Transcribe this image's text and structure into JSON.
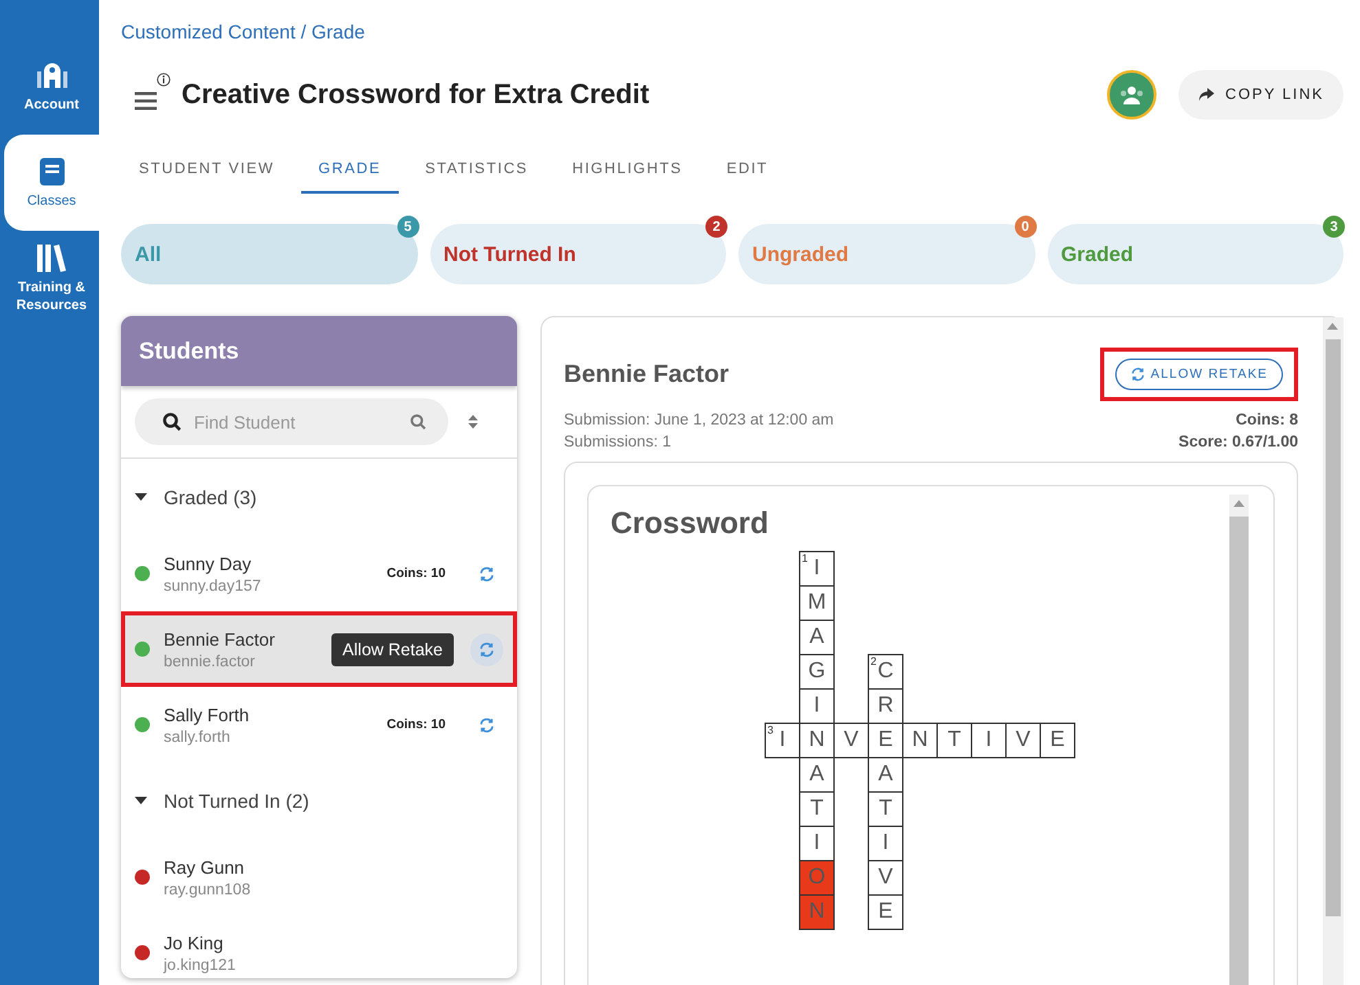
{
  "sidebar": {
    "items": [
      {
        "label": "Account",
        "selected": false
      },
      {
        "label": "Classes",
        "selected": true
      },
      {
        "label": "Training & Resources",
        "selected": false
      }
    ]
  },
  "breadcrumb": "Customized Content / Grade",
  "title": "Creative Crossword for Extra Credit",
  "copy_link": "COPY LINK",
  "tabs": [
    {
      "label": "STUDENT VIEW",
      "selected": false
    },
    {
      "label": "GRADE",
      "selected": true
    },
    {
      "label": "STATISTICS",
      "selected": false
    },
    {
      "label": "HIGHLIGHTS",
      "selected": false
    },
    {
      "label": "EDIT",
      "selected": false
    }
  ],
  "filters": [
    {
      "label": "All",
      "count": "5",
      "color": "#3a98a8",
      "selected": true
    },
    {
      "label": "Not Turned In",
      "count": "2",
      "color": "#c0332b",
      "selected": false
    },
    {
      "label": "Ungraded",
      "count": "0",
      "color": "#e07a45",
      "selected": false
    },
    {
      "label": "Graded",
      "count": "3",
      "color": "#4e9a3f",
      "selected": false
    }
  ],
  "students_panel": {
    "title": "Students",
    "search": {
      "placeholder": "Find Student"
    },
    "groups": [
      {
        "label": "Graded (3)",
        "expanded": true,
        "students": [
          {
            "name": "Sunny Day",
            "username": "sunny.day157",
            "color": "#4caf50",
            "coins": "Coins: 10",
            "retake": true,
            "selected": false,
            "annotated": false
          },
          {
            "name": "Bennie Factor",
            "username": "bennie.factor",
            "color": "#4caf50",
            "tooltip": "Allow Retake",
            "retake": true,
            "selected": true,
            "annotated": true
          },
          {
            "name": "Sally Forth",
            "username": "sally.forth",
            "color": "#4caf50",
            "coins": "Coins: 10",
            "retake": true,
            "selected": false,
            "annotated": false
          }
        ]
      },
      {
        "label": "Not Turned In (2)",
        "expanded": true,
        "students": [
          {
            "name": "Ray Gunn",
            "username": "ray.gunn108",
            "color": "#c62828",
            "retake": false,
            "selected": false,
            "annotated": false
          },
          {
            "name": "Jo King",
            "username": "jo.king121",
            "color": "#c62828",
            "retake": false,
            "selected": false,
            "annotated": false
          }
        ]
      }
    ]
  },
  "detail": {
    "name": "Bennie Factor",
    "allow_retake": {
      "label": "ALLOW RETAKE",
      "annotated": true
    },
    "submission": "Submission: June 1, 2023 at 12:00 am",
    "submissions": "Submissions: 1",
    "coins": "Coins: 8",
    "score": "Score: 0.67/1.00",
    "crossword": {
      "title": "Crossword",
      "grid": [
        [
          {
            "kind": "blank"
          },
          {
            "kind": "letter",
            "letter": "I",
            "number": "1",
            "incorrect": false
          },
          {
            "kind": "blank"
          },
          {
            "kind": "blank"
          },
          {
            "kind": "blank"
          },
          {
            "kind": "blank"
          },
          {
            "kind": "blank"
          },
          {
            "kind": "blank"
          },
          {
            "kind": "blank"
          }
        ],
        [
          {
            "kind": "blank"
          },
          {
            "kind": "letter",
            "letter": "M",
            "incorrect": false
          },
          {
            "kind": "blank"
          },
          {
            "kind": "blank"
          },
          {
            "kind": "blank"
          },
          {
            "kind": "blank"
          },
          {
            "kind": "blank"
          },
          {
            "kind": "blank"
          },
          {
            "kind": "blank"
          }
        ],
        [
          {
            "kind": "blank"
          },
          {
            "kind": "letter",
            "letter": "A",
            "incorrect": false
          },
          {
            "kind": "blank"
          },
          {
            "kind": "blank"
          },
          {
            "kind": "blank"
          },
          {
            "kind": "blank"
          },
          {
            "kind": "blank"
          },
          {
            "kind": "blank"
          },
          {
            "kind": "blank"
          }
        ],
        [
          {
            "kind": "blank"
          },
          {
            "kind": "letter",
            "letter": "G",
            "incorrect": false
          },
          {
            "kind": "blank"
          },
          {
            "kind": "letter",
            "letter": "C",
            "number": "2",
            "incorrect": false
          },
          {
            "kind": "blank"
          },
          {
            "kind": "blank"
          },
          {
            "kind": "blank"
          },
          {
            "kind": "blank"
          },
          {
            "kind": "blank"
          }
        ],
        [
          {
            "kind": "blank"
          },
          {
            "kind": "letter",
            "letter": "I",
            "incorrect": false
          },
          {
            "kind": "blank"
          },
          {
            "kind": "letter",
            "letter": "R",
            "incorrect": false
          },
          {
            "kind": "blank"
          },
          {
            "kind": "blank"
          },
          {
            "kind": "blank"
          },
          {
            "kind": "blank"
          },
          {
            "kind": "blank"
          }
        ],
        [
          {
            "kind": "letter",
            "letter": "I",
            "number": "3",
            "incorrect": false
          },
          {
            "kind": "letter",
            "letter": "N",
            "incorrect": false
          },
          {
            "kind": "letter",
            "letter": "V",
            "incorrect": false
          },
          {
            "kind": "letter",
            "letter": "E",
            "incorrect": false
          },
          {
            "kind": "letter",
            "letter": "N",
            "incorrect": false
          },
          {
            "kind": "letter",
            "letter": "T",
            "incorrect": false
          },
          {
            "kind": "letter",
            "letter": "I",
            "incorrect": false
          },
          {
            "kind": "letter",
            "letter": "V",
            "incorrect": false
          },
          {
            "kind": "letter",
            "letter": "E",
            "incorrect": false
          }
        ],
        [
          {
            "kind": "blank"
          },
          {
            "kind": "letter",
            "letter": "A",
            "incorrect": false
          },
          {
            "kind": "blank"
          },
          {
            "kind": "letter",
            "letter": "A",
            "incorrect": false
          },
          {
            "kind": "blank"
          },
          {
            "kind": "blank"
          },
          {
            "kind": "blank"
          },
          {
            "kind": "blank"
          },
          {
            "kind": "blank"
          }
        ],
        [
          {
            "kind": "blank"
          },
          {
            "kind": "letter",
            "letter": "T",
            "incorrect": false
          },
          {
            "kind": "blank"
          },
          {
            "kind": "letter",
            "letter": "T",
            "incorrect": false
          },
          {
            "kind": "blank"
          },
          {
            "kind": "blank"
          },
          {
            "kind": "blank"
          },
          {
            "kind": "blank"
          },
          {
            "kind": "blank"
          }
        ],
        [
          {
            "kind": "blank"
          },
          {
            "kind": "letter",
            "letter": "I",
            "incorrect": false
          },
          {
            "kind": "blank"
          },
          {
            "kind": "letter",
            "letter": "I",
            "incorrect": false
          },
          {
            "kind": "blank"
          },
          {
            "kind": "blank"
          },
          {
            "kind": "blank"
          },
          {
            "kind": "blank"
          },
          {
            "kind": "blank"
          }
        ],
        [
          {
            "kind": "blank"
          },
          {
            "kind": "letter",
            "letter": "O",
            "incorrect": true
          },
          {
            "kind": "blank"
          },
          {
            "kind": "letter",
            "letter": "V",
            "incorrect": false
          },
          {
            "kind": "blank"
          },
          {
            "kind": "blank"
          },
          {
            "kind": "blank"
          },
          {
            "kind": "blank"
          },
          {
            "kind": "blank"
          }
        ],
        [
          {
            "kind": "blank"
          },
          {
            "kind": "letter",
            "letter": "N",
            "incorrect": true
          },
          {
            "kind": "blank"
          },
          {
            "kind": "letter",
            "letter": "E",
            "incorrect": false
          },
          {
            "kind": "blank"
          },
          {
            "kind": "blank"
          },
          {
            "kind": "blank"
          },
          {
            "kind": "blank"
          },
          {
            "kind": "blank"
          }
        ]
      ]
    }
  }
}
